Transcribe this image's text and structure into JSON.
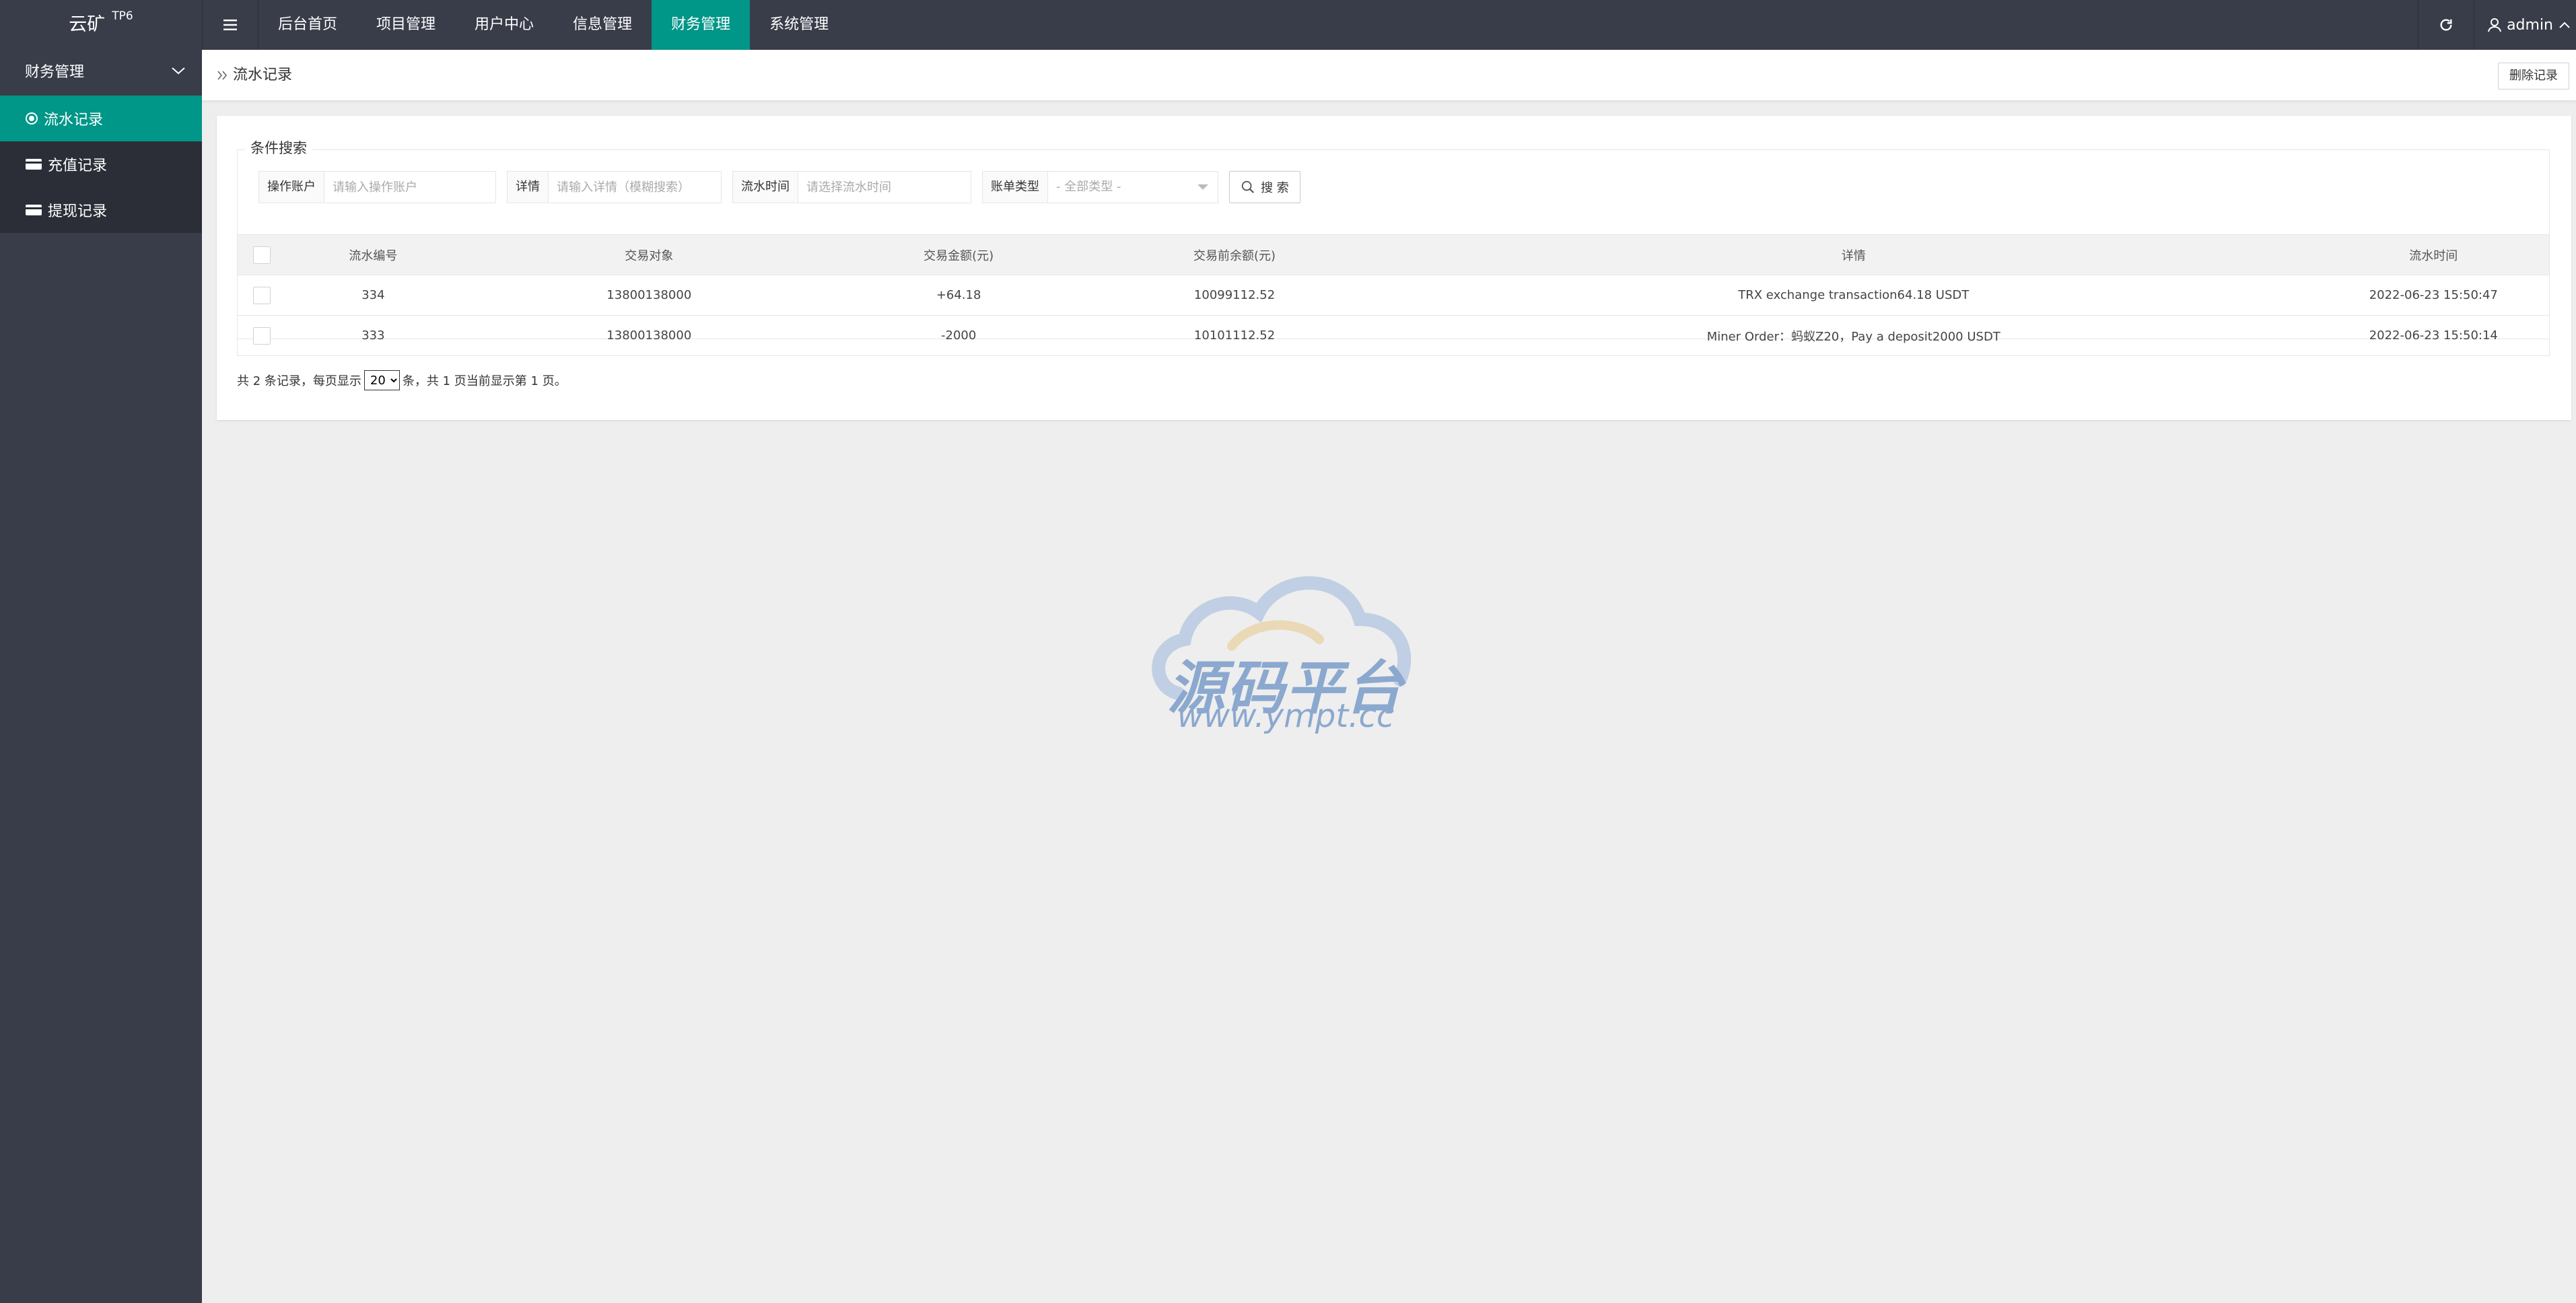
{
  "header": {
    "logo": "云矿",
    "logo_sup": "TP6",
    "nav": [
      {
        "label": "后台首页"
      },
      {
        "label": "项目管理"
      },
      {
        "label": "用户中心"
      },
      {
        "label": "信息管理"
      },
      {
        "label": "财务管理"
      },
      {
        "label": "系统管理"
      }
    ],
    "active_nav": "财务管理",
    "user": "admin",
    "active_color": "#009688"
  },
  "sidebar": {
    "group": "财务管理",
    "items": [
      {
        "label": "流水记录",
        "icon": "radio-icon"
      },
      {
        "label": "充值记录",
        "icon": "card-icon"
      },
      {
        "label": "提现记录",
        "icon": "card-icon"
      }
    ],
    "active_item": "流水记录"
  },
  "breadcrumb": {
    "title": "流水记录",
    "action": "删除记录"
  },
  "search": {
    "legend": "条件搜索",
    "fields": [
      {
        "label": "操作账户",
        "placeholder": "请输入操作账户"
      },
      {
        "label": "详情",
        "placeholder": "请输入详情（模糊搜索）"
      },
      {
        "label": "流水时间",
        "placeholder": "请选择流水时间"
      }
    ],
    "select": {
      "label": "账单类型",
      "value": "- 全部类型 -"
    },
    "button": "搜 索"
  },
  "table": {
    "headers": [
      "流水编号",
      "交易对象",
      "交易金额(元)",
      "交易前余额(元)",
      "详情",
      "流水时间"
    ],
    "rows": [
      {
        "id": "334",
        "target": "13800138000",
        "amount": "+64.18",
        "before": "10099112.52",
        "detail": "TRX exchange transaction64.18 USDT",
        "time": "2022-06-23 15:50:47"
      },
      {
        "id": "333",
        "target": "13800138000",
        "amount": "-2000",
        "before": "10101112.52",
        "detail": "Miner Order：蚂蚁Z20，Pay a deposit2000 USDT",
        "time": "2022-06-23 15:50:14"
      }
    ]
  },
  "pager": {
    "prefix": "共 2 条记录，每页显示",
    "page_size": "20",
    "suffix": "条，共 1 页当前显示第 1 页。"
  },
  "watermark": {
    "title": "源码平台",
    "url": "www.ympt.cc"
  }
}
